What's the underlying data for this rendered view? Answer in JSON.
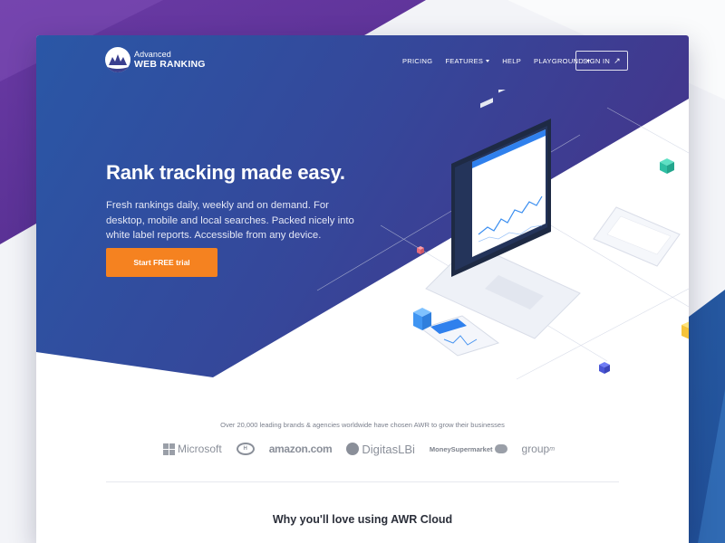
{
  "brand": {
    "line1": "Advanced",
    "line2": "WEB RANKING"
  },
  "nav": {
    "items": [
      {
        "label": "PRICING",
        "dropdown": false
      },
      {
        "label": "FEATURES",
        "dropdown": true
      },
      {
        "label": "HELP",
        "dropdown": false
      },
      {
        "label": "PLAYGROUND",
        "dropdown": true
      }
    ],
    "signin_label": "SIGN IN",
    "signin_icon": "arrow-up-right-icon"
  },
  "hero": {
    "title": "Rank tracking made easy.",
    "description": "Fresh rankings daily, weekly and on demand. For desktop, mobile and local searches. Packed nicely into white label reports. Accessible from any device.",
    "cta_label": "Start FREE trial"
  },
  "clients": {
    "caption": "Over 20,000 leading brands & agencies worldwide have chosen AWR to grow their businesses",
    "logos": [
      "Microsoft",
      "HSBC",
      "amazon.com",
      "DigitasLBi",
      "MoneySupermarket",
      "group"
    ],
    "logos_suffix": {
      "group": "m"
    }
  },
  "section": {
    "title": "Why you'll love using AWR Cloud"
  },
  "colors": {
    "hero_blue": "#2a57a6",
    "hero_purple": "#4a2e86",
    "cta_orange": "#f58220"
  }
}
